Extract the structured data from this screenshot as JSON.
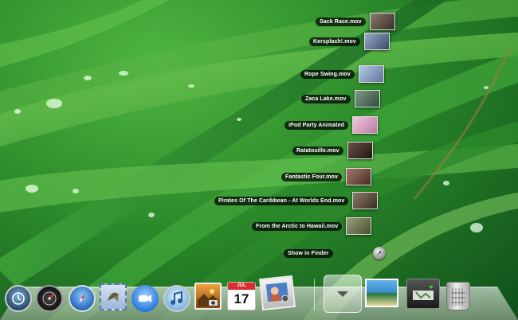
{
  "stack": {
    "items": [
      {
        "label": "Sack Race.mov",
        "color": "#6b5a4a"
      },
      {
        "label": "Kersplash!.mov",
        "color": "#5a6b86"
      },
      {
        "label": "Rope Swing.mov",
        "color": "#7c8fb2"
      },
      {
        "label": "Zaca Lake.mov",
        "color": "#4e6d5a"
      },
      {
        "label": "iPod Party Animated",
        "color": "#d9a6c6"
      },
      {
        "label": "Ratatouille.mov",
        "color": "#4a3a30"
      },
      {
        "label": "Fantastic Four.mov",
        "color": "#7a5a50"
      },
      {
        "label": "Pirates Of The Caribbean - At Worlds End.mov",
        "color": "#6a5848"
      },
      {
        "label": "From the Arctic to Hawaii.mov",
        "color": "#6b7050"
      }
    ],
    "show_in_finder": "Show in Finder"
  },
  "dock": {
    "icons": [
      {
        "name": "time-machine-icon",
        "color": "#3f5d7a"
      },
      {
        "name": "dashboard-icon",
        "color": "#2b2b2b"
      },
      {
        "name": "safari-icon",
        "color": "#3a7fd0"
      },
      {
        "name": "mail-icon",
        "color": "#8ab0d8"
      },
      {
        "name": "ichat-icon",
        "color": "#3c8ee8"
      },
      {
        "name": "itunes-icon",
        "color": "#6fb6e8"
      },
      {
        "name": "iphoto-icon",
        "color": "#c77a2e"
      },
      {
        "name": "ical-icon",
        "color": "#ffffff"
      },
      {
        "name": "preview-icon",
        "color": "#4a78b8"
      }
    ],
    "ical_month": "JUL",
    "ical_day": "17"
  }
}
